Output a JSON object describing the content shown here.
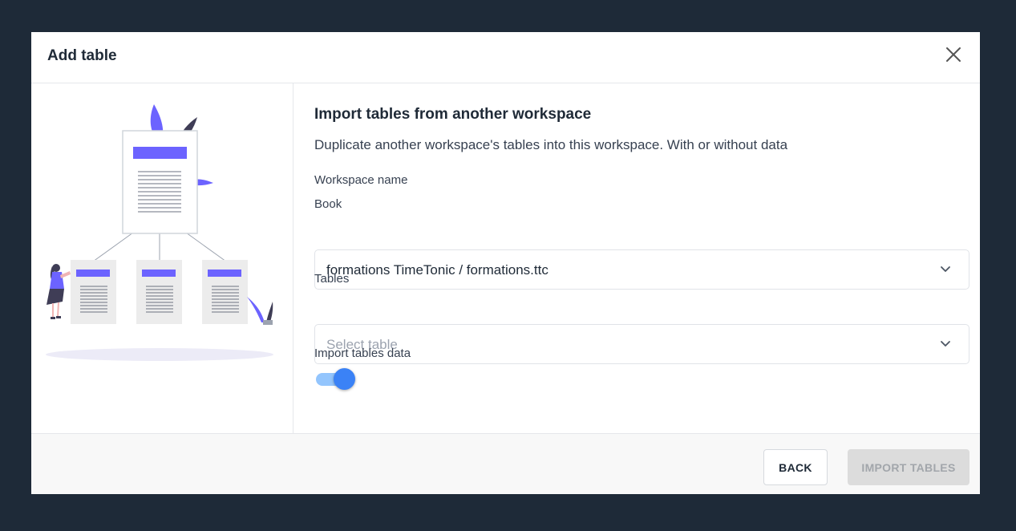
{
  "modal": {
    "title": "Add table",
    "close_icon": "close-icon"
  },
  "form": {
    "title": "Import tables from another workspace",
    "description": "Duplicate another workspace's tables into this workspace. With or without data",
    "workspace_label": "Workspace name",
    "book": {
      "label": "Book",
      "value": "formations TimeTonic / formations.ttc"
    },
    "tables": {
      "label": "Tables",
      "placeholder": "Select table"
    },
    "import_data": {
      "label": "Import tables data",
      "checked": true
    }
  },
  "footer": {
    "back_label": "BACK",
    "import_label": "IMPORT TABLES"
  },
  "colors": {
    "backdrop": "#1e2a38",
    "accent": "#3b82f6",
    "illustration_accent": "#6c63ff"
  }
}
